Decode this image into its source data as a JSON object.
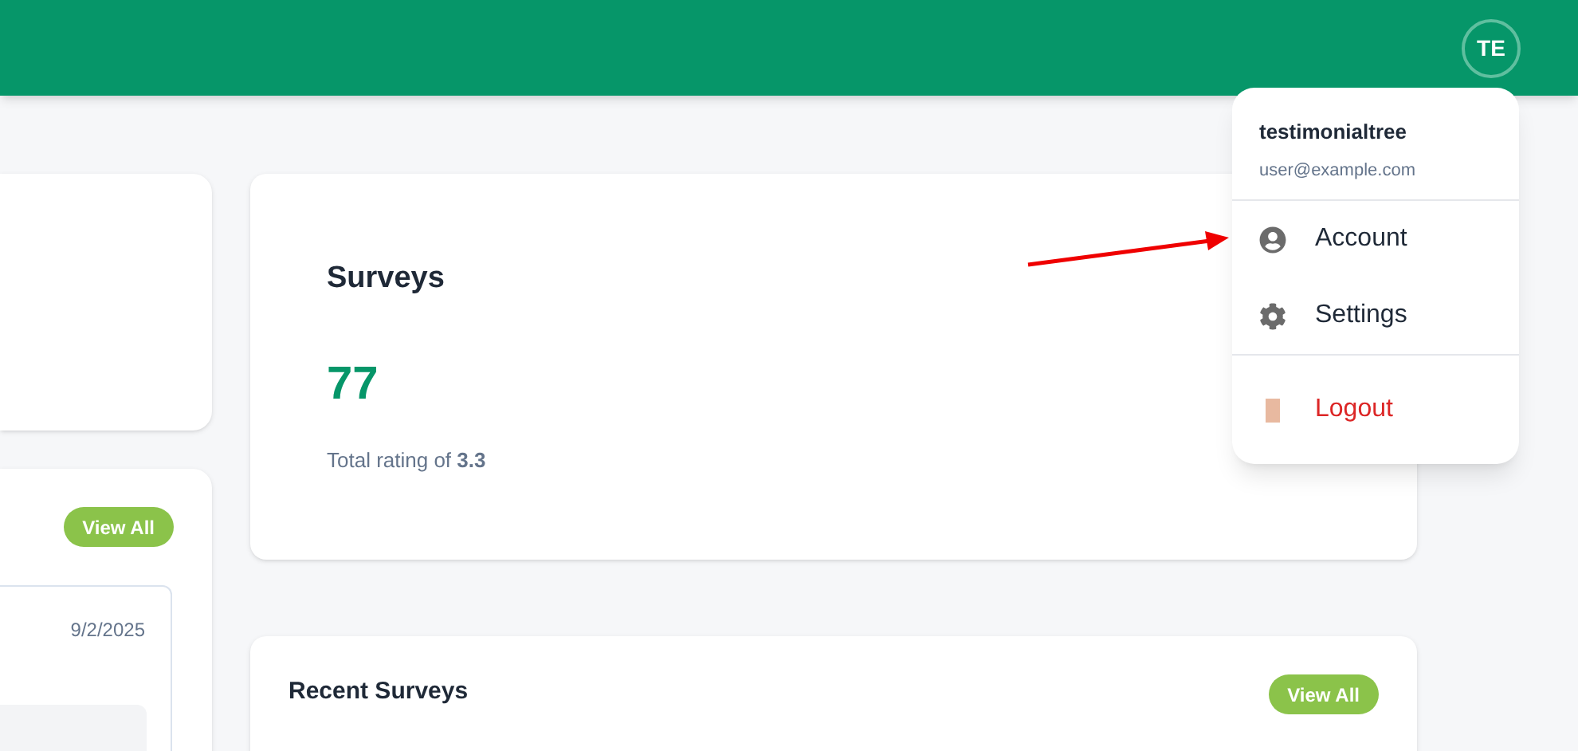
{
  "header": {
    "avatar_initials": "TE"
  },
  "left_panel": {
    "button": "View All",
    "item_date": "9/2/2025"
  },
  "surveys_card": {
    "title": "Surveys",
    "count": "77",
    "subtitle": "Total rating of **3.3**"
  },
  "recent_surveys": {
    "title": "Recent Surveys",
    "button": "View All"
  },
  "user_menu": {
    "name": "testimonialtree",
    "email": "user@example.com",
    "items": [
      {
        "kind": "account",
        "label": "Account"
      },
      {
        "kind": "settings",
        "label": "Settings"
      },
      {
        "kind": "logout",
        "label": "Logout"
      }
    ]
  }
}
